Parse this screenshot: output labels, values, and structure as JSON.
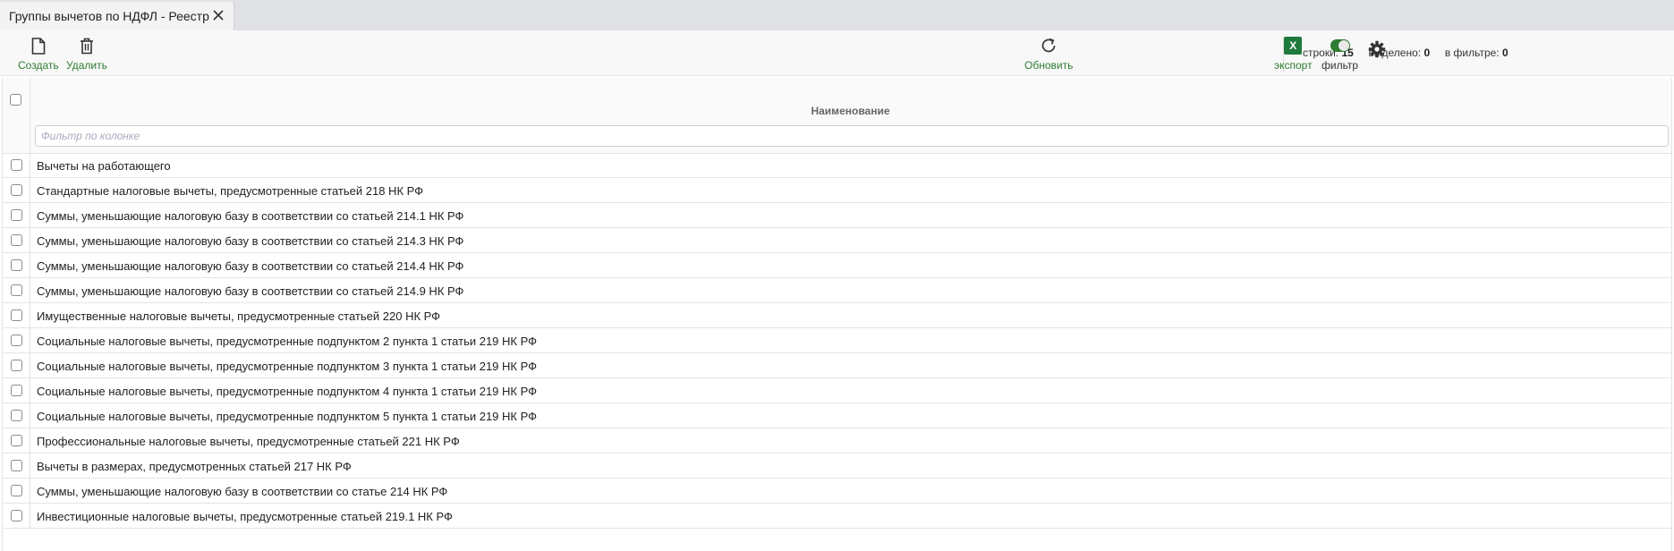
{
  "tab": {
    "title": "Группы вычетов по НДФЛ - Реестр"
  },
  "toolbar": {
    "create_label": "Создать",
    "delete_label": "Удалить",
    "refresh_label": "Обновить",
    "stats": {
      "rows_label": "строки:",
      "rows_value": "15",
      "selected_label": "выделено:",
      "selected_value": "0",
      "in_filter_label": "в фильтре:",
      "in_filter_value": "0"
    },
    "export_label": "экспорт",
    "export_badge": "X",
    "filter_label": "фильтр",
    "filter_enabled": true
  },
  "grid": {
    "column_header": "Наименование",
    "filter_placeholder": "Фильтр по колонке",
    "rows": [
      "Вычеты на работающего",
      "Стандартные налоговые вычеты, предусмотренные статьей 218 НК РФ",
      "Суммы, уменьшающие налоговую базу в соответствии со статьей 214.1 НК РФ",
      "Суммы, уменьшающие налоговую базу в соответствии со статьей 214.3 НК РФ",
      "Суммы, уменьшающие налоговую базу в соответствии со статьей 214.4 НК РФ",
      "Суммы, уменьшающие налоговую базу в соответствии со статьей 214.9 НК РФ",
      "Имущественные налоговые вычеты, предусмотренные статьей 220 НК РФ",
      "Социальные налоговые вычеты, предусмотренные подпунктом 2 пункта 1 статьи 219 НК РФ",
      "Социальные налоговые вычеты, предусмотренные подпунктом 3 пункта 1 статьи 219 НК РФ",
      "Социальные налоговые вычеты, предусмотренные подпунктом 4 пункта 1 статьи 219 НК РФ",
      "Социальные налоговые вычеты, предусмотренные подпунктом 5 пункта 1 статьи 219 НК РФ",
      "Профессиональные налоговые вычеты, предусмотренные статьей 221 НК РФ",
      "Вычеты в размерах, предусмотренных статьей 217 НК РФ",
      "Суммы, уменьшающие налоговую базу в соответствии со статье 214 НК РФ",
      "Инвестиционные налоговые вычеты, предусмотренные статьей 219.1 НК РФ"
    ]
  },
  "colors": {
    "accent_green": "#2e7d32",
    "excel_green": "#1e7a3c"
  }
}
